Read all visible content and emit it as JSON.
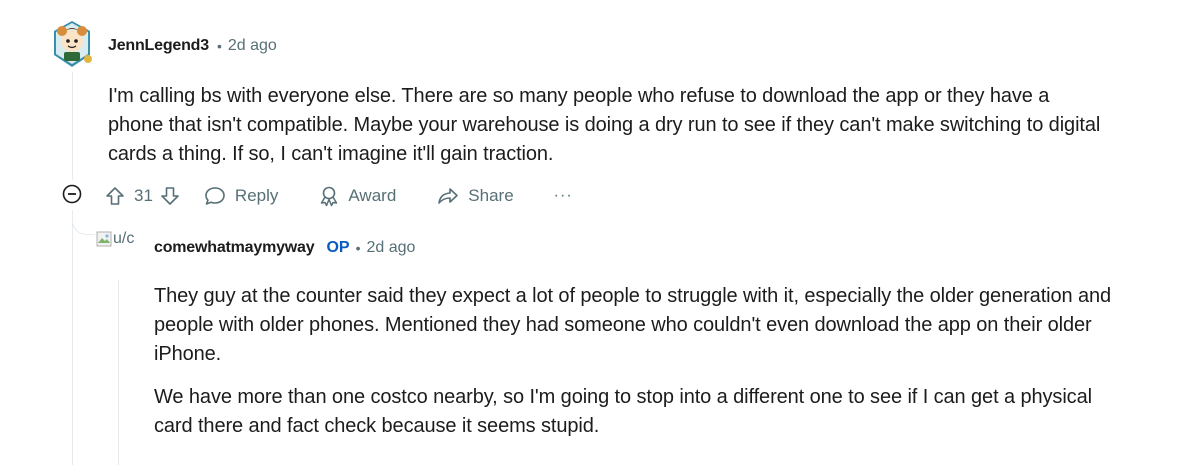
{
  "comment1": {
    "author": "JennLegend3",
    "separator": "•",
    "time": "2d ago",
    "body": "I'm calling bs with everyone else. There are so many people who refuse to download the app or they have a phone that isn't compatible. Maybe your warehouse is doing a dry run to see if they can't make switching to digital cards a thing. If so, I can't imagine it'll gain traction.",
    "actions": {
      "upvote_icon": "arrow-up-icon",
      "vote_count": "31",
      "downvote_icon": "arrow-down-icon",
      "reply_label": "Reply",
      "award_label": "Award",
      "share_label": "Share",
      "more_label": "···"
    }
  },
  "comment2": {
    "avatar_alt": "u/c",
    "author": "comewhatmaymyway",
    "op_badge": "OP",
    "separator": "•",
    "time": "2d ago",
    "paragraphs": [
      "They guy at the counter said they expect a lot of people to struggle with it, especially the older generation and people with older phones. Mentioned they had someone who couldn't even download the app on their older iPhone.",
      "We have more than one costco nearby, so I'm going to stop into a different one to see if I can get a physical card there and fact check because it seems stupid."
    ]
  },
  "colors": {
    "text": "#1c1c1c",
    "meta": "#576f76",
    "op": "#0a5bc0",
    "thread_line": "#e5ebee"
  }
}
